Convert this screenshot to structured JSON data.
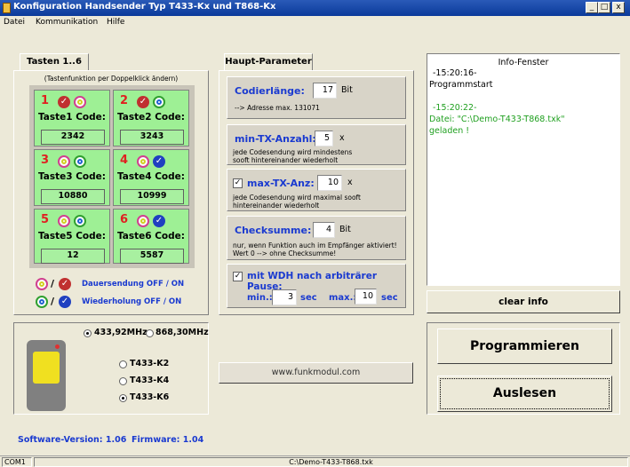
{
  "window": {
    "title": "Konfiguration Handsender Typ T433-Kx und T868-Kx",
    "min": "_",
    "max": "□",
    "close": "x"
  },
  "menu": {
    "datei": "Datei",
    "kommunikation": "Kommunikation",
    "hilfe": "Hilfe"
  },
  "tasten": {
    "tab_label": "Tasten 1..6",
    "hint": "(Tastenfunktion per Doppelklick ändern)",
    "keys": [
      {
        "num": "1",
        "label": "Taste1 Code:",
        "code": "2342"
      },
      {
        "num": "2",
        "label": "Taste2 Code:",
        "code": "3243"
      },
      {
        "num": "3",
        "label": "Taste3 Code:",
        "code": "10880"
      },
      {
        "num": "4",
        "label": "Taste4 Code:",
        "code": "10999"
      },
      {
        "num": "5",
        "label": "Taste5 Code:",
        "code": "12"
      },
      {
        "num": "6",
        "label": "Taste6 Code:",
        "code": "5587"
      }
    ],
    "legend1_sep": "/",
    "legend1": "Dauersendung OFF / ON",
    "legend2_sep": "/",
    "legend2": "Wiederholung OFF / ON"
  },
  "freq": {
    "opt1": "433,92MHz",
    "opt2": "868,30MHz",
    "types": [
      "T433-K2",
      "T433-K4",
      "T433-K6"
    ]
  },
  "haupt": {
    "tab_label": "Haupt-Parameter",
    "codier_label": "Codierlänge:",
    "codier_value": "17",
    "codier_unit": "Bit",
    "codier_note": "--> Adresse max. 131071",
    "mintx_label": "min-TX-Anzahl:",
    "mintx_value": "5",
    "mintx_unit": "x",
    "mintx_note": "jede Codesendung wird mindestens sooft hintereinander wiederholt",
    "maxtx_label": "max-TX-Anz:",
    "maxtx_value": "10",
    "maxtx_unit": "x",
    "maxtx_note": "jede Codesendung wird maximal sooft hintereinander wiederholt",
    "check_label": "Checksumme:",
    "check_value": "4",
    "check_unit": "Bit",
    "check_note": "nur, wenn Funktion auch im Empfänger aktiviert! Wert 0 --> ohne Checksumme!",
    "wdh_label": "mit WDH nach arbiträrer Pause:",
    "min_label": "min.:",
    "min_value": "3",
    "min_unit": "sec",
    "max_label": "max.:",
    "max_value": "10",
    "max_unit": "sec"
  },
  "link": "www.funkmodul.com",
  "info": {
    "title": "Info-Fenster",
    "line1": "-15:20:16-",
    "line2": "Programmstart",
    "line3": "-15:20:22-",
    "line4": "Datei: \"C:\\Demo-T433-T868.txk\"",
    "line5": "geladen !",
    "clear": "clear info"
  },
  "buttons": {
    "programmieren": "Programmieren",
    "auslesen": "Auslesen"
  },
  "version": {
    "software": "Software-Version: 1.06",
    "firmware": "Firmware: 1.04"
  },
  "status": {
    "port": "COM1",
    "file": "C:\\Demo-T433-T868.txk"
  },
  "colors": {
    "title_bar": "#0a3a9a",
    "key_green": "#9ef095",
    "param_blue": "#1a3ad0",
    "key_num_red": "#e02020",
    "info_green": "#20a020"
  }
}
